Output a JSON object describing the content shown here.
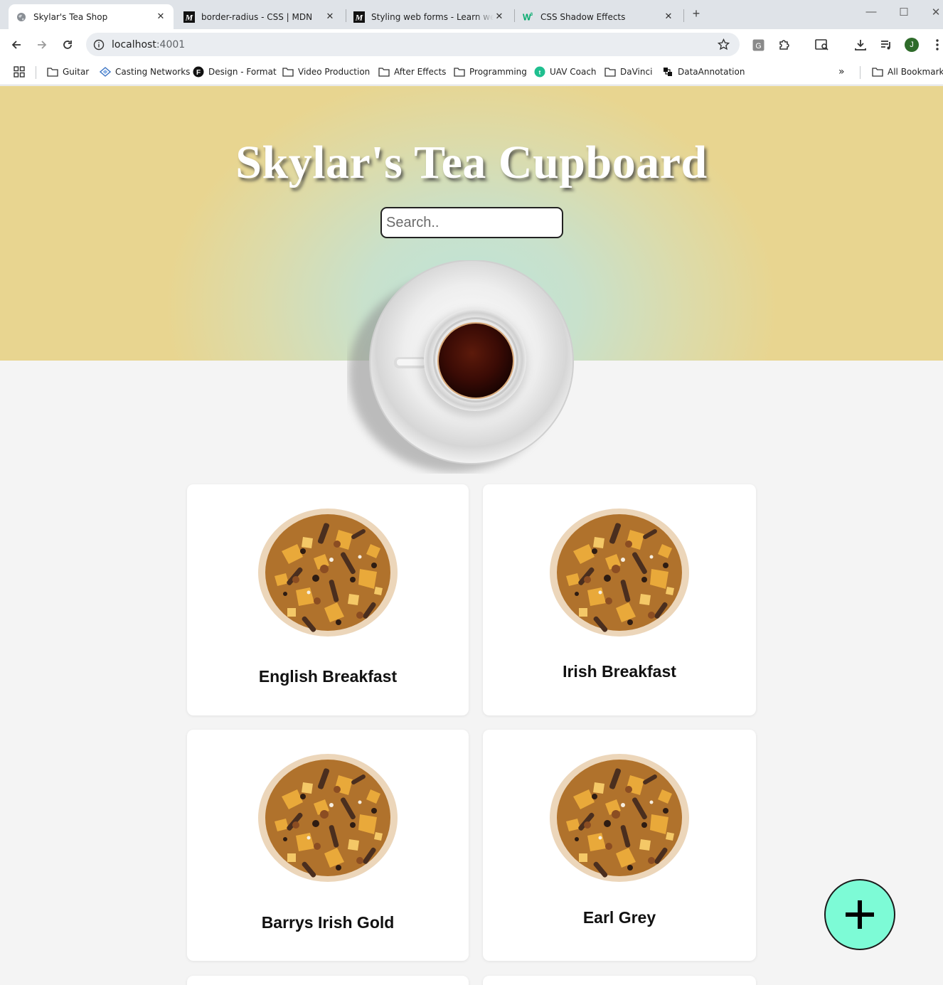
{
  "browser": {
    "tabs": [
      {
        "title": "Skylar's Tea Shop",
        "favicon": "globe-icon",
        "active": true
      },
      {
        "title": "border-radius - CSS | MDN",
        "favicon": "mdn-icon",
        "active": false
      },
      {
        "title": "Styling web forms - Learn web d",
        "favicon": "mdn-icon",
        "active": false
      },
      {
        "title": "CSS Shadow Effects",
        "favicon": "w3schools-icon",
        "active": false
      }
    ],
    "url_host": "localhost",
    "url_port": ":4001",
    "avatar_initial": "J",
    "bookmarks": [
      {
        "label": "Guitar",
        "icon": "folder-icon"
      },
      {
        "label": "Casting Networks",
        "icon": "casting-icon"
      },
      {
        "label": "Design - Format",
        "icon": "format-icon"
      },
      {
        "label": "Video Production",
        "icon": "folder-icon"
      },
      {
        "label": "After Effects",
        "icon": "folder-icon"
      },
      {
        "label": "Programming",
        "icon": "folder-icon"
      },
      {
        "label": "UAV Coach",
        "icon": "uav-icon"
      },
      {
        "label": "DaVinci",
        "icon": "folder-icon"
      },
      {
        "label": "DataAnnotation",
        "icon": "dataannotation-icon"
      }
    ],
    "all_bookmarks": "All Bookmarks"
  },
  "page": {
    "title": "Skylar's Tea Cupboard",
    "search_placeholder": "Search..",
    "teas": [
      {
        "name": "English Breakfast"
      },
      {
        "name": "Irish Breakfast"
      },
      {
        "name": "Barrys Irish Gold"
      },
      {
        "name": "Earl Grey"
      }
    ],
    "add_button_icon": "plus-icon"
  },
  "colors": {
    "hero_yellow": "#e8d590",
    "hero_mint": "#bfe3d8",
    "fab": "#7dfbd6",
    "background": "#f4f4f4"
  }
}
